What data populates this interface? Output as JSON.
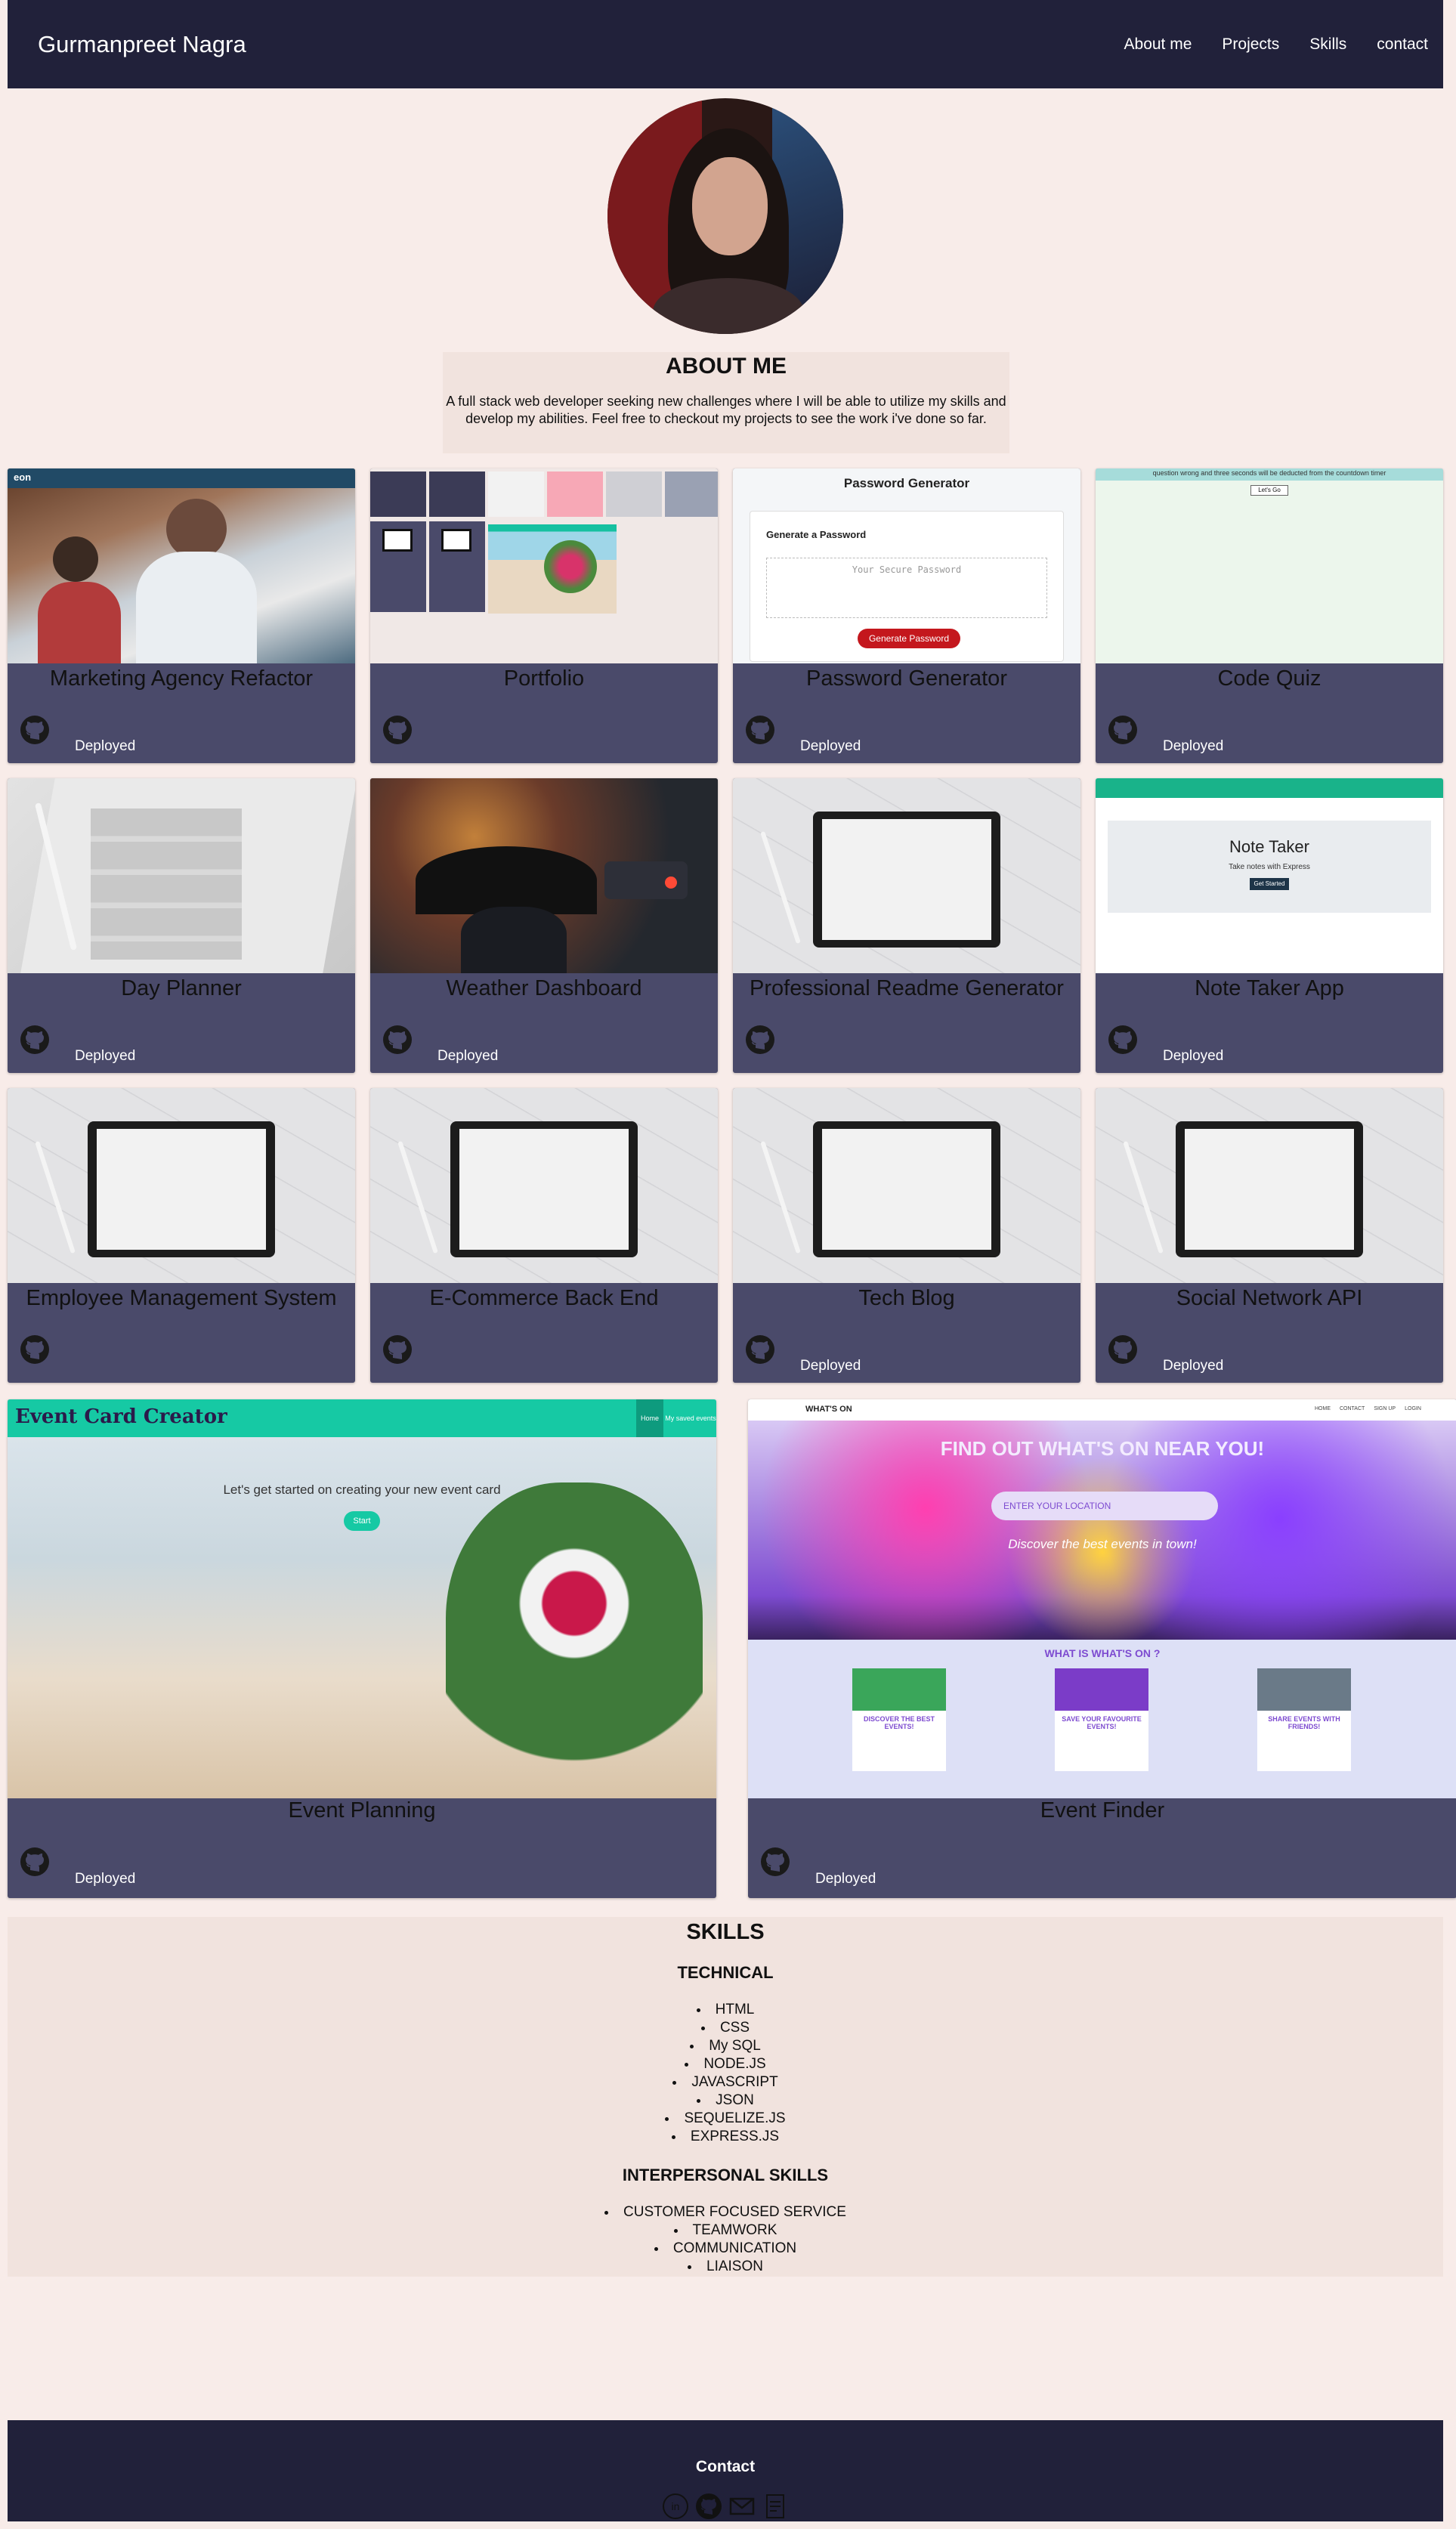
{
  "nav": {
    "brand": "Gurmanpreet Nagra",
    "links": [
      "About me",
      "Projects",
      "Skills",
      "contact"
    ]
  },
  "about": {
    "heading": "ABOUT ME",
    "text": "A full stack web developer seeking new challenges where I will be able to utilize my skills and develop my abilities. Feel free to checkout my projects to see the work i've done so far."
  },
  "projects": [
    {
      "title": "Marketing Agency Refactor",
      "deployed": "Deployed"
    },
    {
      "title": "Portfolio",
      "deployed": ""
    },
    {
      "title": "Password Generator",
      "deployed": "Deployed"
    },
    {
      "title": "Code Quiz",
      "deployed": "Deployed"
    },
    {
      "title": "Day Planner",
      "deployed": "Deployed"
    },
    {
      "title": "Weather Dashboard",
      "deployed": "Deployed"
    },
    {
      "title": "Professional Readme Generator",
      "deployed": ""
    },
    {
      "title": "Note Taker App",
      "deployed": "Deployed"
    },
    {
      "title": "Employee Management System",
      "deployed": ""
    },
    {
      "title": "E-Commerce Back End",
      "deployed": ""
    },
    {
      "title": "Tech Blog",
      "deployed": "Deployed"
    },
    {
      "title": "Social Network API",
      "deployed": "Deployed"
    },
    {
      "title": "Event Planning",
      "deployed": "Deployed"
    },
    {
      "title": "Event Finder",
      "deployed": "Deployed"
    }
  ],
  "previews": {
    "password": {
      "heading": "Password Generator",
      "subheading": "Generate a Password",
      "placeholder": "Your Secure Password",
      "button": "Generate Password"
    },
    "quiz": {
      "banner": "question wrong and three seconds will be deducted from the countdown timer",
      "button": "Let's Go"
    },
    "note": {
      "title": "Note Taker",
      "subtitle": "Take notes with Express",
      "button": "Get Started"
    },
    "event_card": {
      "logo": "Event Card Creator",
      "nav_home": "Home",
      "nav_saved": "My saved events",
      "prompt": "Let's get started on creating your new event card",
      "start": "Start"
    },
    "event_finder": {
      "logo": "WHAT'S ON",
      "nav": [
        "HOME",
        "CONTACT",
        "SIGN UP",
        "LOGIN"
      ],
      "headline": "FIND OUT WHAT'S ON NEAR YOU!",
      "location_placeholder": "ENTER YOUR LOCATION",
      "tagline": "Discover the best events in town!",
      "section": "WHAT IS WHAT'S ON ?",
      "features": [
        "DISCOVER THE BEST EVENTS!",
        "SAVE YOUR FAVOURITE EVENTS!",
        "SHARE EVENTS WITH FRIENDS!"
      ]
    }
  },
  "skills": {
    "heading": "SKILLS",
    "technical_heading": "TECHNICAL",
    "technical": [
      "HTML",
      "CSS",
      "My SQL",
      "NODE.JS",
      "JAVASCRIPT",
      "JSON",
      "SEQUELIZE.JS",
      "EXPRESS.JS"
    ],
    "interpersonal_heading": "INTERPERSONAL SKILLS",
    "interpersonal": [
      "CUSTOMER FOCUSED SERVICE",
      "TEAMWORK",
      "COMMUNICATION",
      "LIAISON"
    ]
  },
  "footer": {
    "heading": "Contact",
    "icons": [
      "linkedin-icon",
      "github-icon",
      "email-icon",
      "resume-icon"
    ]
  },
  "colors": {
    "nav_bg": "#21213a",
    "page_bg": "#f8ece9",
    "card_bg": "#4a4a6a",
    "section_bg": "#f1e3de"
  }
}
